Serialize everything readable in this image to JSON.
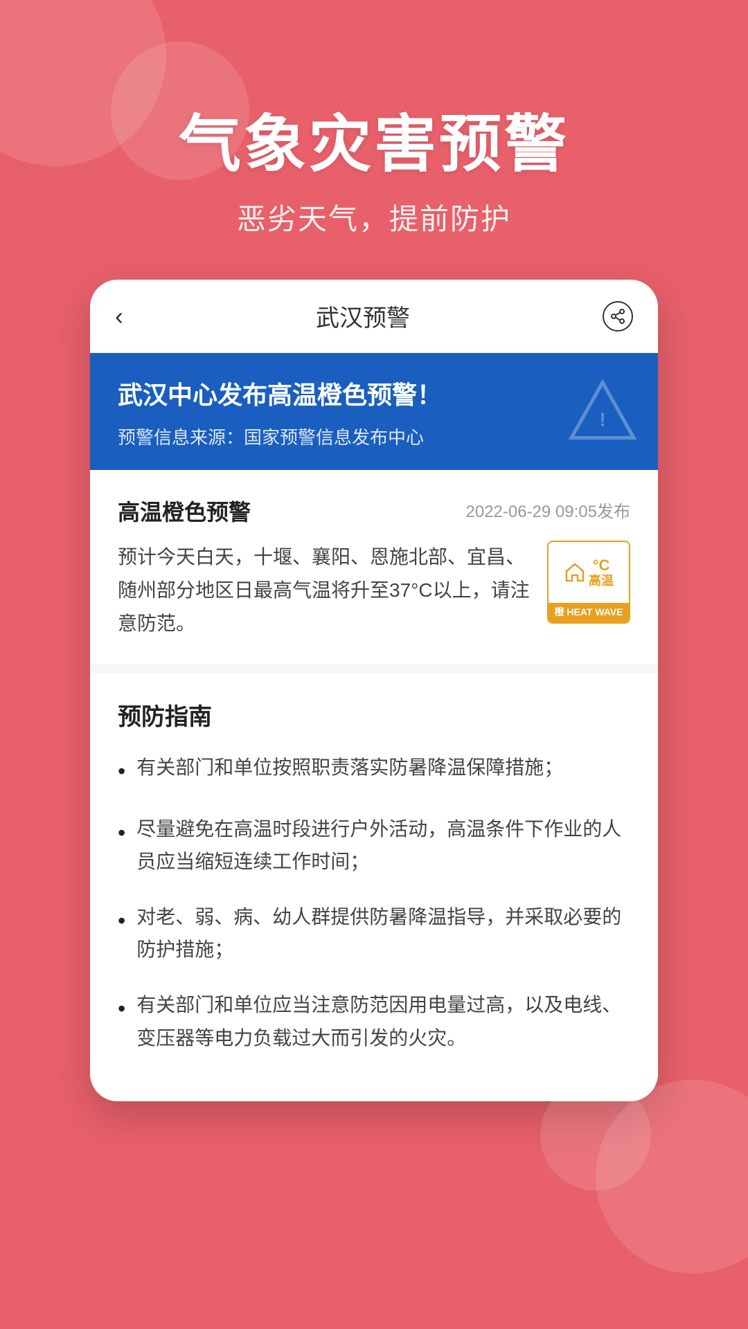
{
  "background": {
    "color": "#e8606a"
  },
  "header": {
    "main_title": "气象灾害预警",
    "sub_title": "恶劣天气，提前防护"
  },
  "app_bar": {
    "back_label": "‹",
    "title": "武汉预警",
    "share_icon": "↗"
  },
  "alert_banner": {
    "title": "武汉中心发布高温橙色预警！",
    "source_label": "预警信息来源：国家预警信息发布中心"
  },
  "warning_info": {
    "title": "高温橙色预警",
    "date": "2022-06-29 09:05发布",
    "text": "预计今天白天，十堰、襄阳、恩施北部、宜昌、随州部分地区日最高气温将升至37°C以上，请注意防范。",
    "badge": {
      "celsius": "°C",
      "label_top": "高温",
      "label_bottom": "橙 HEAT WAVE"
    }
  },
  "prevention": {
    "title": "预防指南",
    "items": [
      "有关部门和单位按照职责落实防暑降温保障措施；",
      "尽量避免在高温时段进行户外活动，高温条件下作业的人员应当缩短连续工作时间；",
      "对老、弱、病、幼人群提供防暑降温指导，并采取必要的防护措施；",
      "有关部门和单位应当注意防范因用电量过高，以及电线、变压器等电力负载过大而引发的火灾。"
    ]
  }
}
